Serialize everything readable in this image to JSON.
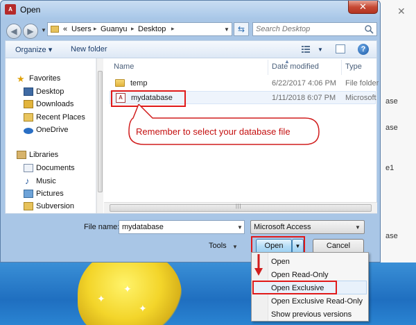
{
  "dialog": {
    "title": "Open",
    "app_icon": "A",
    "close_icon": "✕"
  },
  "address": {
    "prefix": "«",
    "crumbs": [
      "Users",
      "Guanyu",
      "Desktop"
    ],
    "search_placeholder": "Search Desktop"
  },
  "toolbar": {
    "organize": "Organize ▾",
    "new_folder": "New folder"
  },
  "nav": {
    "favorites": "Favorites",
    "desktop": "Desktop",
    "downloads": "Downloads",
    "recent": "Recent Places",
    "onedrive": "OneDrive",
    "libraries": "Libraries",
    "documents": "Documents",
    "music": "Music",
    "pictures": "Pictures",
    "subversion": "Subversion"
  },
  "files": {
    "headers": {
      "name": "Name",
      "date": "Date modified",
      "type": "Type"
    },
    "rows": [
      {
        "name": "temp",
        "date": "6/22/2017 4:06 PM",
        "type": "File folder"
      },
      {
        "name": "mydatabase",
        "date": "1/11/2018 6:07 PM",
        "type": "Microsoft"
      }
    ]
  },
  "callout": "Remember to select your database file",
  "bottom": {
    "file_name_label": "File name:",
    "file_name_value": "mydatabase",
    "file_type": "Microsoft Access",
    "tools": "Tools",
    "open": "Open",
    "cancel": "Cancel"
  },
  "menu": {
    "items": [
      "Open",
      "Open Read-Only",
      "Open Exclusive",
      "Open Exclusive Read-Only",
      "Show previous versions"
    ]
  },
  "background": {
    "close_icon": "✕",
    "snippets": [
      "ase",
      "ase",
      "e1",
      "ase"
    ]
  },
  "colors": {
    "highlight_red": "#e01919",
    "callout_text": "#c40f0f"
  }
}
